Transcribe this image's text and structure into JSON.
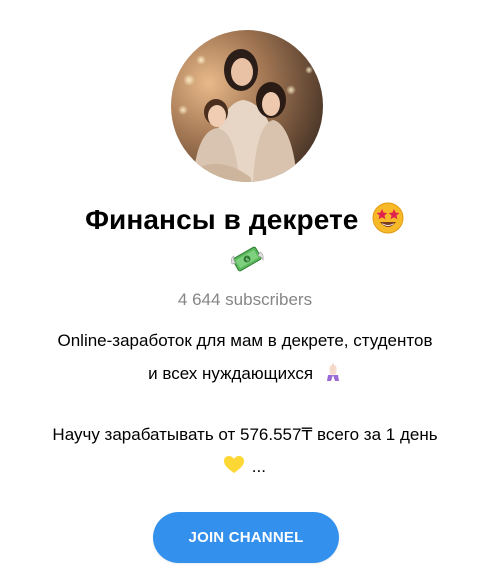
{
  "channel": {
    "avatar": {
      "icon": "channel-avatar-photo",
      "description": "mother with two daughters"
    },
    "title": "Финансы в декрете",
    "title_emoji": "star-struck-emoji-icon",
    "badge_emoji": "money-with-wings-emoji-icon",
    "subscribers": "4 644 subscribers"
  },
  "description": {
    "line1": "Online-заработок для мам в декрете, студентов",
    "line2": "и всех нуждающихся",
    "line2_emoji": "folded-hands-emoji-icon",
    "line3": "Научу зарабатывать от 576.557₸ всего за 1 день",
    "line4_emoji": "yellow-heart-emoji-icon",
    "line4": "..."
  },
  "actions": {
    "join_label": "JOIN CHANNEL"
  },
  "colors": {
    "accent": "#3390ec",
    "muted_text": "#868686",
    "text": "#000000",
    "background": "#ffffff"
  }
}
